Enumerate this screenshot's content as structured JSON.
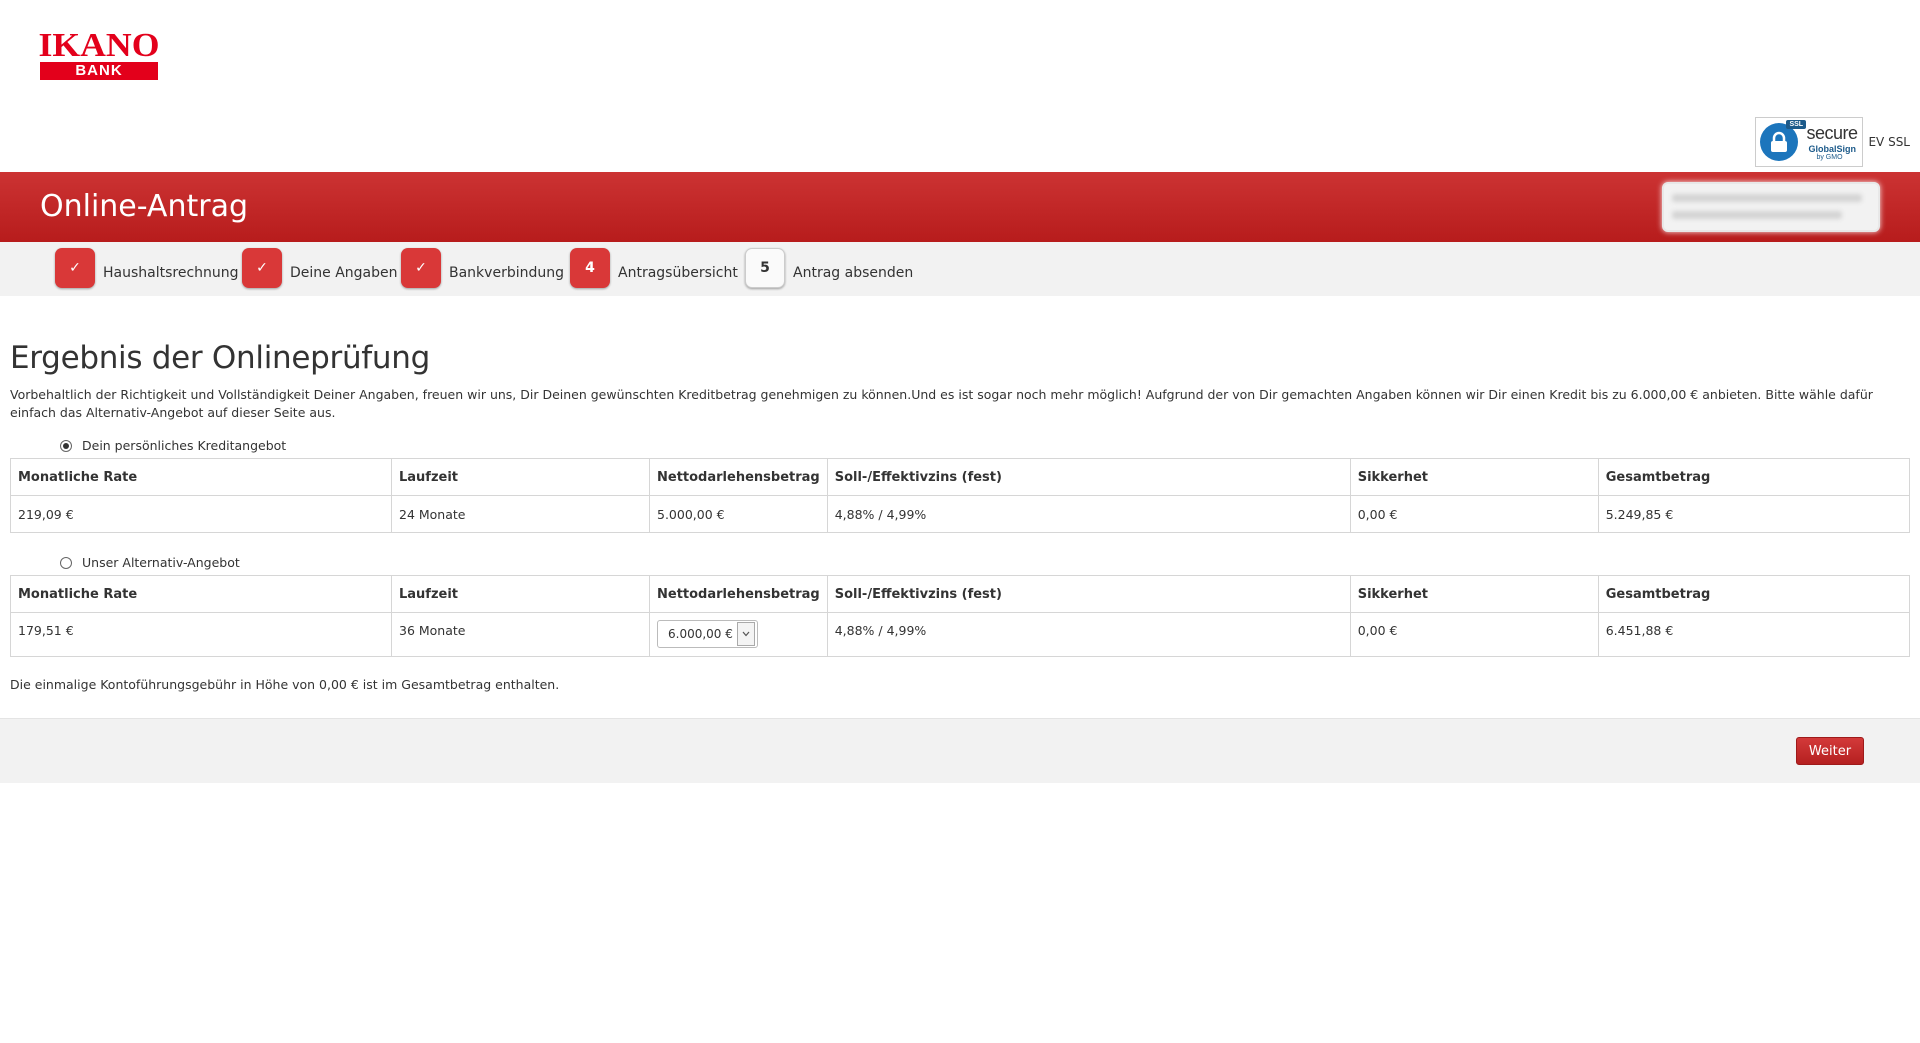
{
  "brand": {
    "logo_top": "IKANO",
    "logo_bottom": "BANK"
  },
  "ssl": {
    "tag": "SSL",
    "secure": "secure",
    "provider": "GlobalSign",
    "by": "by GMO",
    "ev_label": "EV SSL"
  },
  "header": {
    "title": "Online-Antrag"
  },
  "steps": [
    {
      "badge": "✓",
      "label": "Haushaltsrechnung"
    },
    {
      "badge": "✓",
      "label": "Deine Angaben"
    },
    {
      "badge": "✓",
      "label": "Bankverbindung"
    },
    {
      "badge": "4",
      "label": "Antragsübersicht"
    },
    {
      "badge": "5",
      "label": "Antrag absenden"
    }
  ],
  "main": {
    "heading": "Ergebnis der Onlineprüfung",
    "intro": "Vorbehaltlich der Richtigkeit und Vollständigkeit Deiner Angaben, freuen wir uns, Dir Deinen gewünschten Kreditbetrag genehmigen zu können.Und es ist sogar noch mehr möglich! Aufgrund der von Dir gemachten Angaben können wir Dir einen Kredit bis zu 6.000,00 € anbieten. Bitte wähle dafür einfach das Alternativ-Angebot auf dieser Seite aus.",
    "columns": [
      "Monatliche Rate",
      "Laufzeit",
      "Nettodarlehensbetrag",
      "Soll-/Effektivzins (fest)",
      "Sikkerhet",
      "Gesamtbetrag"
    ],
    "offer1": {
      "label": "Dein persönliches Kreditangebot",
      "selected": true,
      "rate": "219,09 €",
      "term": "24 Monate",
      "amount": "5.000,00 €",
      "interest": "4,88% / 4,99%",
      "security": "0,00 €",
      "total": "5.249,85 €"
    },
    "offer2": {
      "label": "Unser Alternativ-Angebot",
      "selected": false,
      "rate": "179,51 €",
      "term": "36 Monate",
      "amount_selected": "6.000,00 €",
      "interest": "4,88% / 4,99%",
      "security": "0,00 €",
      "total": "6.451,88 €"
    },
    "fee_note": "Die einmalige Kontoführungsgebühr in Höhe von 0,00 € ist im Gesamtbetrag enthalten."
  },
  "footer": {
    "next_label": "Weiter"
  },
  "colors": {
    "brand_red": "#e3001b",
    "band_red": "#c62828",
    "step_red": "#d93838"
  }
}
